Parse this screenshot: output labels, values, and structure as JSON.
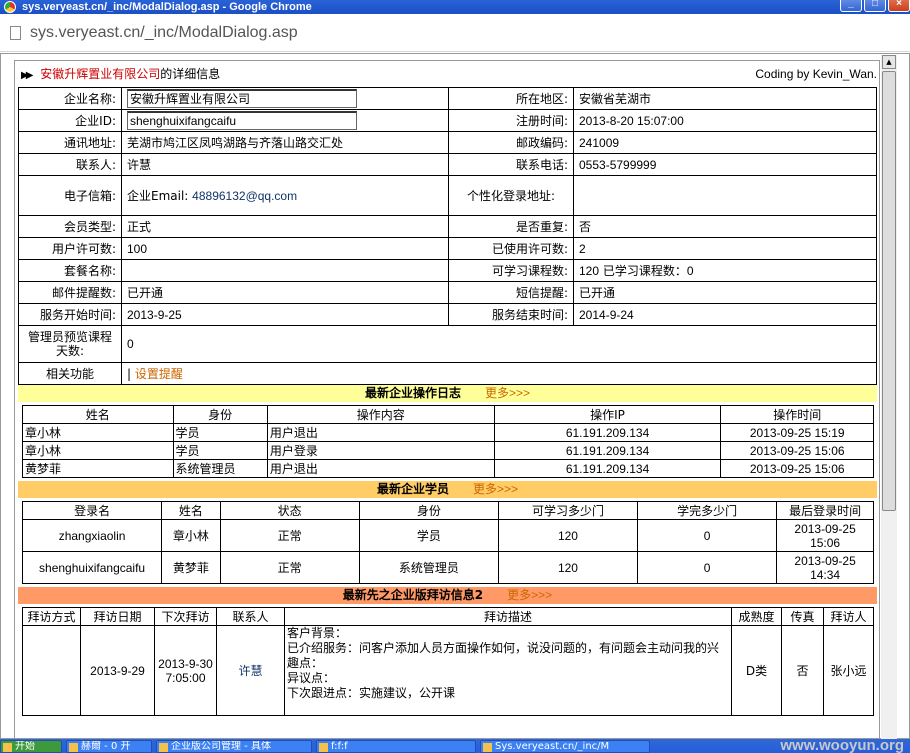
{
  "window": {
    "title": "sys.veryeast.cn/_inc/ModalDialog.asp - Google Chrome",
    "url": "sys.veryeast.cn/_inc/ModalDialog.asp",
    "min_glyph": "_",
    "max_glyph": "□",
    "close_glyph": "×"
  },
  "header": {
    "company": "安徽升辉置业有限公司",
    "suffix": "的详细信息",
    "credit": "Coding by Kevin_Wan."
  },
  "info": {
    "company_name_label": "企业名称:",
    "company_name_value": "安徽升辉置业有限公司",
    "region_label": "所在地区:",
    "region_value": "安徽省芜湖市",
    "company_id_label": "企业ID:",
    "company_id_value": "shenghuixifangcaifu",
    "reg_time_label": "注册时间:",
    "reg_time_value": "2013-8-20 15:07:00",
    "address_label": "通讯地址:",
    "address_value": "芜湖市鸠江区凤鸣湖路与齐落山路交汇处",
    "postcode_label": "邮政编码:",
    "postcode_value": "241009",
    "contact_label": "联系人:",
    "contact_value": "许慧",
    "phone_label": "联系电话:",
    "phone_value": "0553-5799999",
    "email_label": "电子信箱:",
    "email_prefix": "企业Email:",
    "email_value": "48896132@qq.com",
    "custom_login_label": "个性化登录地址:",
    "custom_login_value": "",
    "member_type_label": "会员类型:",
    "member_type_value": "正式",
    "duplicate_label": "是否重复:",
    "duplicate_value": "否",
    "user_license_label": "用户许可数:",
    "user_license_value": "100",
    "used_license_label": "已使用许可数:",
    "used_license_value": "2",
    "package_label": "套餐名称:",
    "package_value": "",
    "course_label": "可学习课程数:",
    "course_value": "120",
    "learned_label": "已学习课程数：",
    "learned_value": "0",
    "mail_remind_label": "邮件提醒数:",
    "mail_remind_value": "已开通",
    "sms_remind_label": "短信提醒:",
    "sms_remind_value": "已开通",
    "service_start_label": "服务开始时间:",
    "service_start_value": "2013-9-25",
    "service_end_label": "服务结束时间:",
    "service_end_value": "2014-9-24",
    "admin_preview_label": "管理员预览课程天数:",
    "admin_preview_value": "0",
    "related_label": "相关功能",
    "related_sep": "|",
    "related_link": "设置提醒"
  },
  "oplog": {
    "title": "最新企业操作日志",
    "more": "更多>>>",
    "headers": [
      "姓名",
      "身份",
      "操作内容",
      "操作IP",
      "操作时间"
    ],
    "rows": [
      [
        "章小林",
        "学员",
        "用户退出",
        "61.191.209.134",
        "2013-09-25 15:19"
      ],
      [
        "章小林",
        "学员",
        "用户登录",
        "61.191.209.134",
        "2013-09-25 15:06"
      ],
      [
        "黄梦菲",
        "系统管理员",
        "用户退出",
        "61.191.209.134",
        "2013-09-25 15:06"
      ]
    ]
  },
  "students": {
    "title": "最新企业学员",
    "more": "更多>>>",
    "headers": [
      "登录名",
      "姓名",
      "状态",
      "身份",
      "可学习多少门",
      "学完多少门",
      "最后登录时间"
    ],
    "rows": [
      [
        "zhangxiaolin",
        "章小林",
        "正常",
        "学员",
        "120",
        "0",
        "2013-09-25 15:06"
      ],
      [
        "shenghuixifangcaifu",
        "黄梦菲",
        "正常",
        "系统管理员",
        "120",
        "0",
        "2013-09-25 14:34"
      ]
    ]
  },
  "visits": {
    "title": "最新先之企业版拜访信息2",
    "more": "更多>>>",
    "headers": [
      "拜访方式",
      "拜访日期",
      "下次拜访",
      "联系人",
      "拜访描述",
      "成熟度",
      "传真",
      "拜访人"
    ],
    "row": {
      "method": "",
      "date": "2013-9-29",
      "next": "2013-9-30 7:05:00",
      "contact": "许慧",
      "desc_lines": [
        "客户背景：",
        "已介绍服务：问客户添加人员方面操作如何，说没问题的，有问题会主动问我的兴趣点：",
        "异议点：",
        "下次跟进点：实施建议，公开课"
      ],
      "maturity": "D类",
      "fax": "否",
      "visitor": "张小远"
    }
  },
  "taskbar": [
    "开始",
    "赫爾 - 0 开",
    "企业版公司管理 - 具体",
    "f:f:f",
    "Sys.veryeast.cn/_inc/M"
  ],
  "watermark": "www.wooyun.org",
  "colors": {
    "titlebar": "#2a63d8",
    "company_red": "#cc0000",
    "link_orange": "#cc6600",
    "oplog_bg": "#ffff99",
    "students_bg": "#ffcc66",
    "visits_bg": "#ff9966"
  }
}
